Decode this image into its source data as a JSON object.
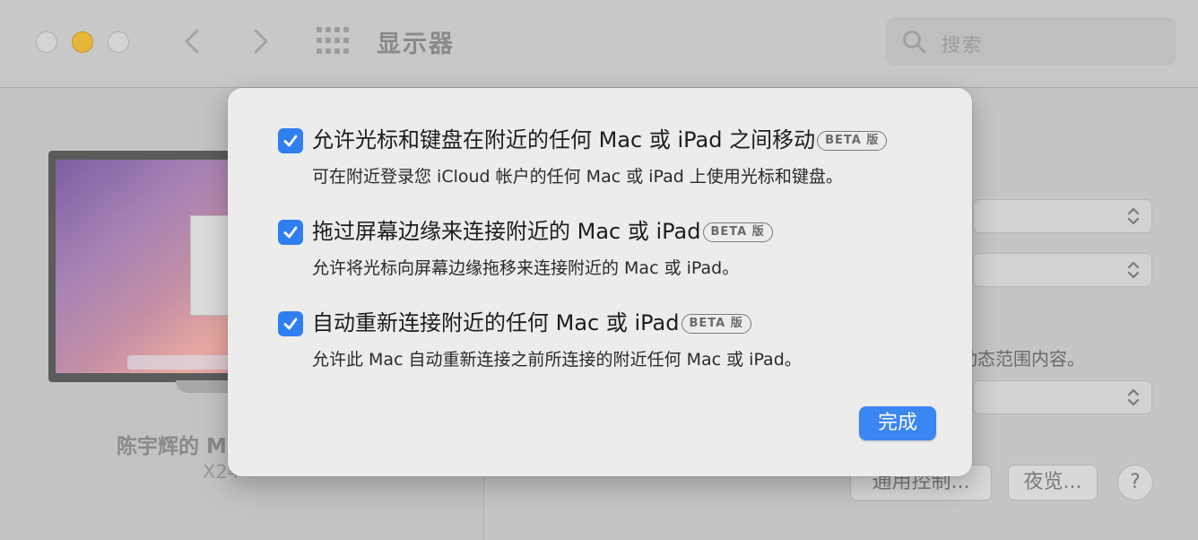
{
  "window": {
    "title": "显示器"
  },
  "search": {
    "placeholder": "搜索"
  },
  "left": {
    "display_name": "陈宇辉的 M",
    "display_model": "X24"
  },
  "right": {
    "bg_text": "动态范围内容。",
    "control_button": "通用控制...",
    "night_button": "夜览...",
    "help": "?"
  },
  "sheet": {
    "options": [
      {
        "title": "允许光标和键盘在附近的任何 Mac 或 iPad 之间移动",
        "badge": "BETA 版",
        "desc": "可在附近登录您 iCloud 帐户的任何 Mac 或 iPad 上使用光标和键盘。",
        "checked": true
      },
      {
        "title": "拖过屏幕边缘来连接附近的 Mac 或 iPad",
        "badge": "BETA 版",
        "desc": "允许将光标向屏幕边缘拖移来连接附近的 Mac 或 iPad。",
        "checked": true
      },
      {
        "title": "自动重新连接附近的任何 Mac 或 iPad",
        "badge": "BETA 版",
        "desc": "允许此 Mac 自动重新连接之前所连接的附近任何 Mac 或 iPad。",
        "checked": true
      }
    ],
    "done": "完成"
  },
  "colors": {
    "accent": "#2f7ff0",
    "done_button": "#3a86f2"
  },
  "icons": [
    "close-icon",
    "minimize-icon",
    "maximize-icon",
    "back-icon",
    "forward-icon",
    "grid-icon",
    "search-icon",
    "chevron-updown-icon",
    "checkmark-icon"
  ]
}
